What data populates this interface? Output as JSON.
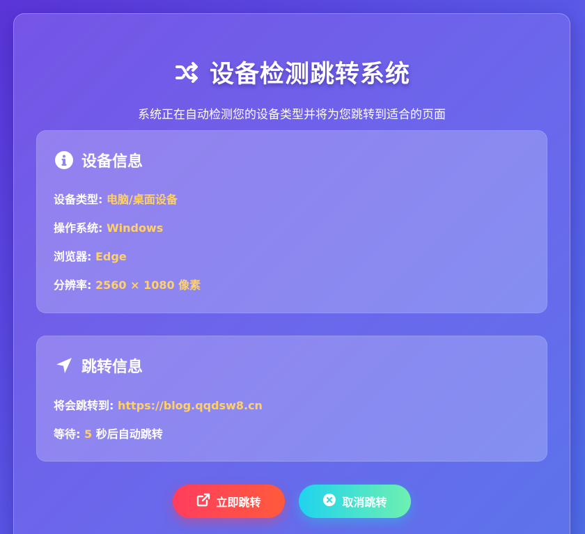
{
  "header": {
    "title": "设备检测跳转系统",
    "title_icon": "shuffle-icon",
    "subtitle": "系统正在自动检测您的设备类型并将为您跳转到适合的页面"
  },
  "device_info": {
    "heading": "设备信息",
    "icon": "info-circle-icon",
    "rows": [
      {
        "label": "设备类型: ",
        "value": "电脑/桌面设备"
      },
      {
        "label": "操作系统: ",
        "value": "Windows"
      },
      {
        "label": "浏览器: ",
        "value": "Edge"
      },
      {
        "label": "分辨率: ",
        "value": "2560 × 1080 像素"
      }
    ]
  },
  "redirect_info": {
    "heading": "跳转信息",
    "icon": "location-arrow-icon",
    "target_label": "将会跳转到: ",
    "target_url": "https://blog.qqdsw8.cn",
    "wait_label": "等待: ",
    "countdown": "5",
    "wait_suffix": " 秒后自动跳转"
  },
  "buttons": {
    "go_now": {
      "label": "立即跳转",
      "icon": "external-link-icon"
    },
    "cancel": {
      "label": "取消跳转",
      "icon": "close-circle-icon"
    }
  },
  "colors": {
    "highlight": "#ffd166",
    "go_gradient_start": "#ff3d5e",
    "cancel_gradient_start": "#1fd3ee",
    "cancel_gradient_end": "#6ef0b0"
  }
}
